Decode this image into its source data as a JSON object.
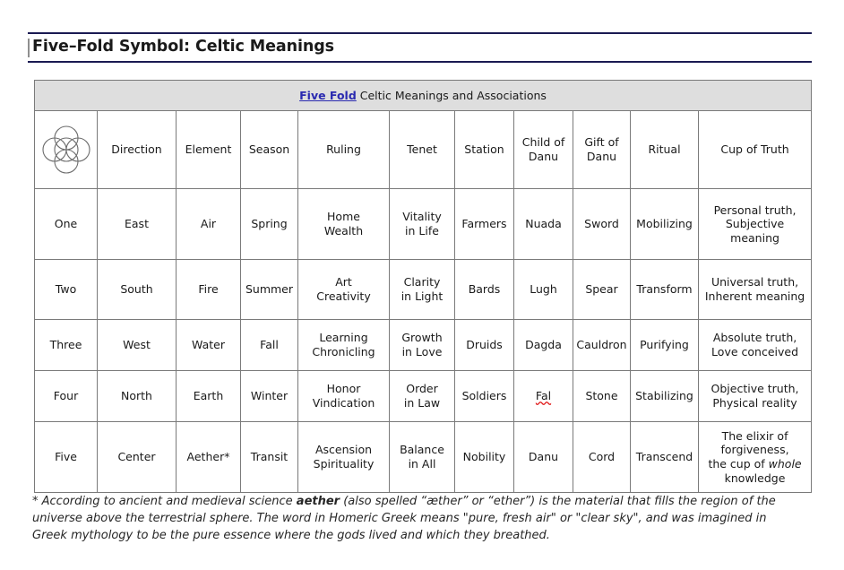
{
  "document": {
    "title": "Five–Fold Symbol: Celtic Meanings"
  },
  "table": {
    "caption_link": "Five Fold",
    "caption_rest": " Celtic Meanings and Associations",
    "symbol_icon": "five-fold-circles-icon",
    "columns": [
      "",
      "Direction",
      "Element",
      "Season",
      "Ruling",
      "Tenet",
      "Station",
      "Child of Danu",
      "Gift of Danu",
      "Ritual",
      "Cup of Truth"
    ],
    "column_lines": [
      [
        "",
        ""
      ],
      [
        "Direction",
        ""
      ],
      [
        "Element",
        ""
      ],
      [
        "Season",
        ""
      ],
      [
        "Ruling",
        ""
      ],
      [
        "Tenet",
        ""
      ],
      [
        "Station",
        ""
      ],
      [
        "Child of",
        "Danu"
      ],
      [
        "Gift of",
        "Danu"
      ],
      [
        "Ritual",
        ""
      ],
      [
        "Cup of Truth",
        ""
      ]
    ],
    "rows": [
      {
        "number": "One",
        "direction": "East",
        "element": "Air",
        "season": "Spring",
        "ruling_1": "Home",
        "ruling_2": "Wealth",
        "tenet_1": "Vitality",
        "tenet_2": "in Life",
        "station": "Farmers",
        "child_of_danu": "Nuada",
        "gift_of_danu": "Sword",
        "ritual": "Mobilizing",
        "cup_1": "Personal truth,",
        "cup_2": "Subjective",
        "cup_3": "meaning"
      },
      {
        "number": "Two",
        "direction": "South",
        "element": "Fire",
        "season": "Summer",
        "ruling_1": "Art",
        "ruling_2": "Creativity",
        "tenet_1": "Clarity",
        "tenet_2": "in Light",
        "station": "Bards",
        "child_of_danu": "Lugh",
        "gift_of_danu": "Spear",
        "ritual": "Transform",
        "cup_1": "Universal truth,",
        "cup_2": "Inherent meaning",
        "cup_3": ""
      },
      {
        "number": "Three",
        "direction": "West",
        "element": "Water",
        "season": "Fall",
        "ruling_1": "Learning",
        "ruling_2": "Chronicling",
        "tenet_1": "Growth",
        "tenet_2": "in Love",
        "station": "Druids",
        "child_of_danu": "Dagda",
        "gift_of_danu": "Cauldron",
        "ritual": "Purifying",
        "cup_1": "Absolute truth,",
        "cup_2": "Love conceived",
        "cup_3": ""
      },
      {
        "number": "Four",
        "direction": "North",
        "element": "Earth",
        "season": "Winter",
        "ruling_1": "Honor",
        "ruling_2": "Vindication",
        "tenet_1": "Order",
        "tenet_2": "in Law",
        "station": "Soldiers",
        "child_of_danu": "Fal",
        "gift_of_danu": "Stone",
        "ritual": "Stabilizing",
        "cup_1": "Objective truth,",
        "cup_2": "Physical reality",
        "cup_3": ""
      },
      {
        "number": "Five",
        "direction": "Center",
        "element": "Aether*",
        "season": "Transit",
        "ruling_1": "Ascension",
        "ruling_2": "Spirituality",
        "tenet_1": "Balance",
        "tenet_2": "in All",
        "station": "Nobility",
        "child_of_danu": "Danu",
        "gift_of_danu": "Cord",
        "ritual": "Transcend",
        "cup_1": "The elixir of",
        "cup_2": "forgiveness,",
        "cup_3": "the cup of whole",
        "cup_4": "knowledge"
      }
    ]
  },
  "footnote": {
    "lead": "* According to ancient and medieval science ",
    "bold_term": "aether",
    "part_2": " (also spelled “æther” or “ether”) is the material that fills the region of the universe above the terrestrial sphere. The word in Homeric Greek means \"pure, fresh air\" or \"clear sky\", and was imagined in Greek mythology to be the pure essence where the gods lived and which they breathed."
  },
  "colors": {
    "rule": "#1a1a52",
    "caption_bg": "#dedede",
    "link": "#2a2ab0",
    "spellcheck": "#e01414",
    "border": "#7a7a7a"
  }
}
